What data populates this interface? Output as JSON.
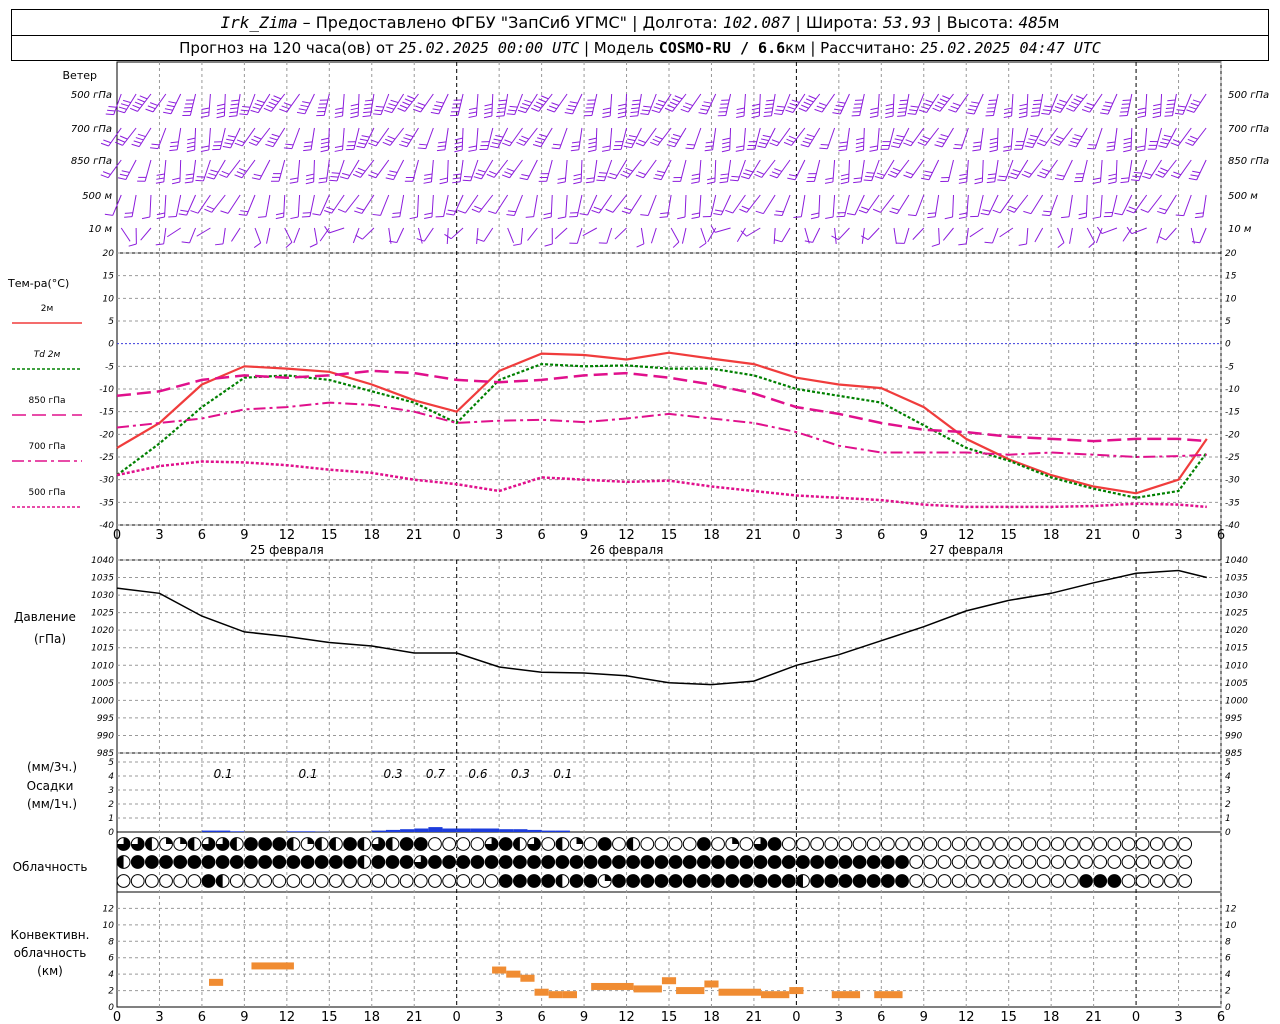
{
  "header": {
    "station": "Irk_Zima",
    "provider": " – Предоставлено ФГБУ \"ЗапСиб УГМС\" | Долгота: ",
    "lon": "102.087",
    "lat_label": " | Широта: ",
    "lat": "53.93",
    "alt_label": " | Высота: ",
    "alt": "485",
    "alt_unit": "м",
    "forecast_label": "Прогноз на 120 часа(ов) от ",
    "forecast_start": "25.02.2025 00:00 UTC",
    "model_label": " | Модель ",
    "model": "COSMO-RU / 6.6",
    "model_unit": "км",
    "calc_label": " | Рассчитано: ",
    "calc_time": "25.02.2025 04:47 UTC"
  },
  "labels": {
    "wind": "Ветер",
    "levels": [
      "500 гПа",
      "700 гПа",
      "850 гПа",
      "500 м",
      "10  м"
    ],
    "temp_title": "Тем-ра(°C)",
    "temp_legend": [
      "2м",
      "Td  2м",
      "850 гПа",
      "700 гПа",
      "500 гПа"
    ],
    "pressure_title": "Давление",
    "pressure_unit": "(гПа)",
    "precip_unit_top": "(мм/3ч.)",
    "precip_title": "Осадки",
    "precip_unit_bottom": "(мм/1ч.)",
    "cloud_title": "Облачность",
    "conv_title": [
      "Конвективн.",
      "облачность",
      "(км)"
    ]
  },
  "colors": {
    "t2m": "#f03c3c",
    "td2m": "#008000",
    "t850": "#e0108c",
    "t700": "#e0108c",
    "t500": "#e0108c",
    "wind": "#8c1cdc",
    "precip": "#1c3cdc",
    "conv": "#f08c32",
    "zero_line": "#3c3cdc",
    "grid": "#999999"
  },
  "chart_data": [
    {
      "type": "line",
      "id": "temperature",
      "x_label_hours": [
        "0",
        "3",
        "6",
        "9",
        "12",
        "15",
        "18",
        "21",
        "0",
        "3",
        "6",
        "9",
        "12",
        "15",
        "18",
        "21",
        "0",
        "3",
        "6",
        "9",
        "12",
        "15",
        "18",
        "21",
        "0",
        "3",
        "6"
      ],
      "days": [
        "25 февраля",
        "26 февраля",
        "27 февраля"
      ],
      "ylim": [
        -40,
        20
      ],
      "yticks": [
        20,
        15,
        10,
        5,
        0,
        -5,
        -10,
        -15,
        -20,
        -25,
        -30,
        -35,
        -40
      ],
      "series": [
        {
          "name": "2м",
          "x": [
            0,
            3,
            6,
            9,
            12,
            15,
            18,
            21,
            24,
            27,
            30,
            33,
            36,
            39,
            42,
            45,
            48,
            51,
            54,
            57,
            60,
            63,
            66,
            69,
            72,
            75,
            77
          ],
          "values": [
            -23,
            -17.5,
            -9,
            -5,
            -5.5,
            -6.2,
            -9,
            -12.5,
            -15,
            -6,
            -2.2,
            -2.5,
            -3.5,
            -2,
            -3.3,
            -4.5,
            -7.5,
            -9,
            -9.8,
            -14,
            -21,
            -25.5,
            -29,
            -31.5,
            -33,
            -30,
            -21
          ]
        },
        {
          "name": "Td  2м",
          "x": [
            0,
            3,
            6,
            9,
            12,
            15,
            18,
            21,
            24,
            27,
            30,
            33,
            36,
            39,
            42,
            45,
            48,
            51,
            54,
            57,
            60,
            63,
            66,
            69,
            72,
            75,
            77
          ],
          "values": [
            -29,
            -22,
            -14,
            -7.5,
            -7,
            -8,
            -10.5,
            -13,
            -17.5,
            -8,
            -4.5,
            -5,
            -4.8,
            -5.5,
            -5.5,
            -7,
            -10,
            -11.5,
            -13,
            -18,
            -23,
            -25.8,
            -29.5,
            -32,
            -34,
            -32.5,
            -24
          ]
        },
        {
          "name": "850 гПа",
          "x": [
            0,
            3,
            6,
            9,
            12,
            15,
            18,
            21,
            24,
            27,
            30,
            33,
            36,
            39,
            42,
            45,
            48,
            51,
            54,
            57,
            60,
            63,
            66,
            69,
            72,
            75,
            77
          ],
          "values": [
            -11.5,
            -10.5,
            -8,
            -7,
            -7.5,
            -7,
            -6,
            -6.5,
            -8,
            -8.5,
            -8,
            -7,
            -6.5,
            -7.5,
            -9,
            -11,
            -14,
            -15.5,
            -17.5,
            -19,
            -19.5,
            -20.5,
            -21,
            -21.5,
            -21,
            -21,
            -21.5
          ]
        },
        {
          "name": "700 гПа",
          "x": [
            0,
            3,
            6,
            9,
            12,
            15,
            18,
            21,
            24,
            27,
            30,
            33,
            36,
            39,
            42,
            45,
            48,
            51,
            54,
            57,
            60,
            63,
            66,
            69,
            72,
            75,
            77
          ],
          "values": [
            -18.5,
            -17.5,
            -16.5,
            -14.5,
            -14,
            -13,
            -13.5,
            -15,
            -17.5,
            -17,
            -16.8,
            -17.3,
            -16.5,
            -15.5,
            -16.5,
            -17.5,
            -19.5,
            -22.5,
            -24,
            -24,
            -24,
            -24.5,
            -24,
            -24.5,
            -25,
            -24.8,
            -24.5
          ]
        },
        {
          "name": "500 гПа",
          "x": [
            0,
            3,
            6,
            9,
            12,
            15,
            18,
            21,
            24,
            27,
            30,
            33,
            36,
            39,
            42,
            45,
            48,
            51,
            54,
            57,
            60,
            63,
            66,
            69,
            72,
            75,
            77
          ],
          "values": [
            -29,
            -27,
            -26,
            -26.2,
            -26.8,
            -27.8,
            -28.5,
            -30,
            -31,
            -32.5,
            -29.5,
            -30,
            -30.5,
            -30.2,
            -31.5,
            -32.5,
            -33.5,
            -34,
            -34.5,
            -35.5,
            -36,
            -36,
            -36,
            -35.8,
            -35.3,
            -35.5,
            -36
          ]
        }
      ]
    },
    {
      "type": "line",
      "id": "pressure",
      "ylim": [
        985,
        1040
      ],
      "yticks": [
        1040,
        1035,
        1030,
        1025,
        1020,
        1015,
        1010,
        1005,
        1000,
        995,
        990,
        985
      ],
      "series": [
        {
          "name": "Давление",
          "x": [
            0,
            3,
            6,
            9,
            12,
            15,
            18,
            21,
            24,
            27,
            30,
            33,
            36,
            39,
            42,
            45,
            48,
            51,
            54,
            57,
            60,
            63,
            66,
            69,
            72,
            75,
            77
          ],
          "values": [
            1032,
            1030.5,
            1024,
            1019.5,
            1018.2,
            1016.5,
            1015.5,
            1013.5,
            1013.5,
            1009.5,
            1008,
            1007.8,
            1007,
            1005,
            1004.5,
            1005.5,
            1010,
            1013,
            1017,
            1021,
            1025.5,
            1028.5,
            1030.5,
            1033.5,
            1036.2,
            1037,
            1035
          ]
        }
      ]
    },
    {
      "type": "bar",
      "id": "precipitation",
      "ylim": [
        0,
        5
      ],
      "yticks": [
        5,
        4,
        3,
        2,
        1,
        0
      ],
      "labels_3h": [
        {
          "x": 7.5,
          "text": "0.1"
        },
        {
          "x": 13.5,
          "text": "0.1"
        },
        {
          "x": 19.5,
          "text": "0.3"
        },
        {
          "x": 22.5,
          "text": "0.7"
        },
        {
          "x": 25.5,
          "text": "0.6"
        },
        {
          "x": 28.5,
          "text": "0.3"
        },
        {
          "x": 31.5,
          "text": "0.1"
        }
      ],
      "x": [
        6,
        7,
        8,
        12,
        13,
        14,
        18,
        19,
        20,
        21,
        22,
        23,
        24,
        25,
        26,
        27,
        28,
        29,
        30,
        31
      ],
      "values": [
        0.1,
        0.1,
        0.05,
        0.05,
        0.05,
        0.02,
        0.1,
        0.15,
        0.2,
        0.25,
        0.35,
        0.25,
        0.25,
        0.25,
        0.25,
        0.2,
        0.2,
        0.15,
        0.1,
        0.1
      ]
    },
    {
      "type": "bar",
      "id": "convective_cloud",
      "ylim": [
        0,
        14
      ],
      "yticks": [
        12,
        10,
        8,
        6,
        4,
        2,
        0
      ],
      "segments": [
        {
          "x0": 6.5,
          "x1": 7.5,
          "y": 3
        },
        {
          "x0": 9.5,
          "x1": 12.5,
          "y": 5
        },
        {
          "x0": 26.5,
          "x1": 27.5,
          "y": 4.5
        },
        {
          "x0": 27.5,
          "x1": 28.5,
          "y": 4
        },
        {
          "x0": 28.5,
          "x1": 29.5,
          "y": 3.5
        },
        {
          "x0": 29.5,
          "x1": 30.5,
          "y": 1.8
        },
        {
          "x0": 30.5,
          "x1": 31.5,
          "y": 1.5
        },
        {
          "x0": 31.5,
          "x1": 32.5,
          "y": 1.5
        },
        {
          "x0": 33.5,
          "x1": 36.5,
          "y": 2.5
        },
        {
          "x0": 36.5,
          "x1": 38.5,
          "y": 2.2
        },
        {
          "x0": 38.5,
          "x1": 39.5,
          "y": 3.2
        },
        {
          "x0": 39.5,
          "x1": 41.5,
          "y": 2
        },
        {
          "x0": 41.5,
          "x1": 42.5,
          "y": 2.8
        },
        {
          "x0": 42.5,
          "x1": 45.5,
          "y": 1.8
        },
        {
          "x0": 45.5,
          "x1": 47.5,
          "y": 1.5
        },
        {
          "x0": 47.5,
          "x1": 48.5,
          "y": 2
        },
        {
          "x0": 50.5,
          "x1": 52.5,
          "y": 1.5
        },
        {
          "x0": 53.5,
          "x1": 55.5,
          "y": 1.5
        }
      ]
    }
  ],
  "wind_rows": {
    "rows": [
      "500 гПа",
      "700 гПа",
      "850 гПа",
      "500 м",
      "10  м"
    ],
    "note": ""
  },
  "cloud_rows": [
    "pphqqhpphfffhqhhfhphffoooopfhpohqofohoooofoqopfooooooooooooooooooooooooooooo",
    "hffffffffffffffffhfffpffffffffffffffffffffffffffffffffffoooooooooooooooooooo",
    "oooooofhoooooooooooooooooooffffhffqfffffffffffffhfffffffoooooooooooofffooooo"
  ]
}
